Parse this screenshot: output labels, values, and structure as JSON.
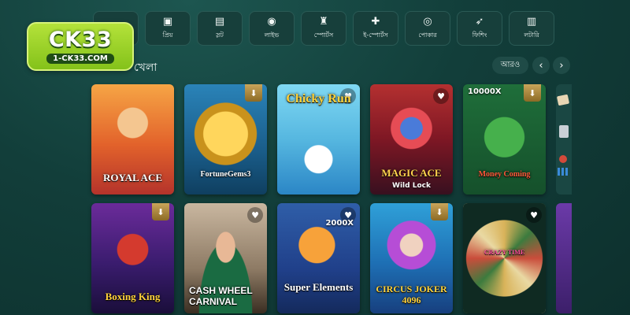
{
  "logo": {
    "main": "CK33",
    "url": "1-CK33.COM"
  },
  "categories": [
    {
      "label": "",
      "icon": "home-icon"
    },
    {
      "label": "প্রিয়",
      "icon": "folder-icon"
    },
    {
      "label": "স্লট",
      "icon": "slot-icon"
    },
    {
      "label": "লাইভ",
      "icon": "film-reel-icon"
    },
    {
      "label": "স্পোর্টস",
      "icon": "stadium-icon"
    },
    {
      "label": "ই-স্পোর্টস",
      "icon": "gamepad-icon"
    },
    {
      "label": "পোকার",
      "icon": "poker-chips-icon"
    },
    {
      "label": "ফিশিং",
      "icon": "fish-icon"
    },
    {
      "label": "লটারি",
      "icon": "lottery-icon"
    }
  ],
  "section": {
    "title": "খেলা",
    "more": "আরও",
    "prev": "‹",
    "next": "›"
  },
  "games": [
    {
      "title": "ROYAL ACE",
      "sub": "",
      "tag": "",
      "badge": "none"
    },
    {
      "title": "FortuneGems3",
      "sub": "",
      "tag": "",
      "badge": "download"
    },
    {
      "title": "Chicky Run",
      "sub": "",
      "tag": "",
      "badge": "favorite"
    },
    {
      "title": "MAGIC ACE",
      "sub": "Wild Lock",
      "tag": "",
      "badge": "favorite"
    },
    {
      "title": "Money Coming",
      "sub": "",
      "tag": "10000X",
      "badge": "download"
    },
    {
      "title": "Boxing King",
      "sub": "",
      "tag": "",
      "badge": "download"
    },
    {
      "title": "CASH WHEEL CARNIVAL",
      "sub": "",
      "tag": "",
      "badge": "favorite"
    },
    {
      "title": "Super Elements",
      "sub": "",
      "tag": "2000X",
      "badge": "favorite"
    },
    {
      "title": "CIRCUS JOKER 4096",
      "sub": "",
      "tag": "",
      "badge": "download"
    },
    {
      "title": "CRAZY TIME",
      "sub": "",
      "tag": "",
      "badge": "favorite"
    }
  ],
  "icons": {
    "favorite": "heart-icon",
    "download": "download-icon"
  }
}
